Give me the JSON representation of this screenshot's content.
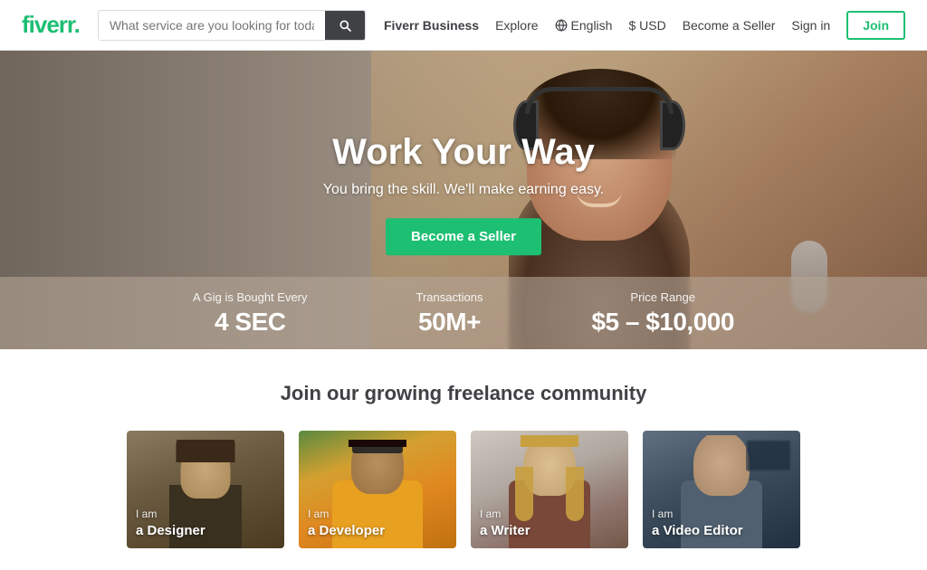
{
  "navbar": {
    "logo_text": "fiverr",
    "logo_dot": ".",
    "search_placeholder": "What service are you looking for today?",
    "links": {
      "business": "Fiverr Business",
      "explore": "Explore",
      "language": "English",
      "currency": "$ USD",
      "become_seller": "Become a Seller",
      "sign_in": "Sign in",
      "join": "Join"
    }
  },
  "hero": {
    "title": "Work Your Way",
    "subtitle": "You bring the skill. We'll make earning easy.",
    "cta_label": "Become a Seller",
    "stats": [
      {
        "label": "A Gig is Bought Every",
        "value": "4 SEC"
      },
      {
        "label": "Transactions",
        "value": "50M+"
      },
      {
        "label": "Price Range",
        "value": "$5 – $10,000"
      }
    ]
  },
  "community": {
    "title": "Join our growing freelance community",
    "cards": [
      {
        "prefix": "I am",
        "role": "a Designer"
      },
      {
        "prefix": "I am",
        "role": "a Developer"
      },
      {
        "prefix": "I am",
        "role": "a Writer"
      },
      {
        "prefix": "I am",
        "role": "a Video Editor"
      }
    ]
  }
}
